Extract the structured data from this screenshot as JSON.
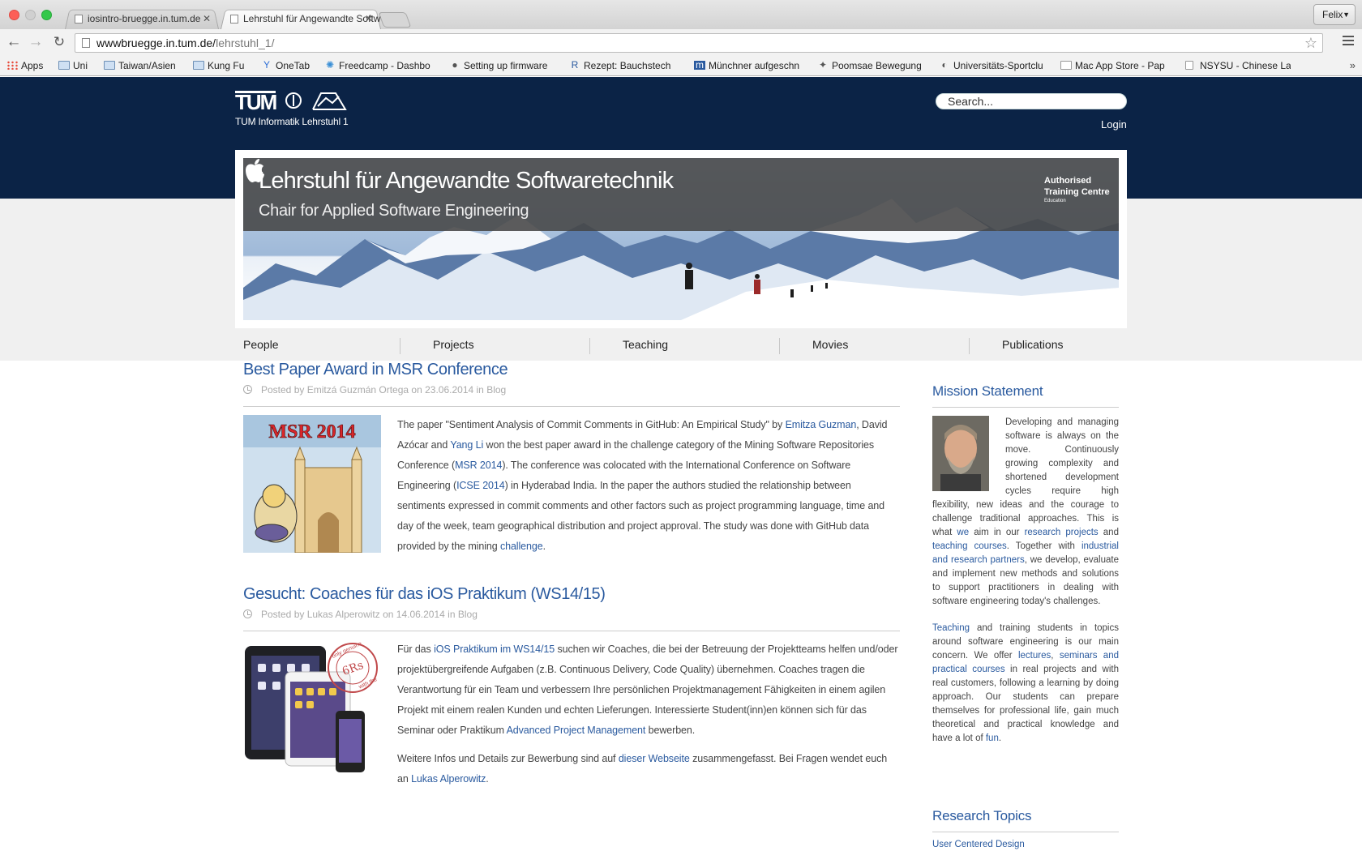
{
  "browser": {
    "tabs": [
      {
        "label": "iosintro-bruegge.in.tum.de"
      },
      {
        "label": "Lehrstuhl für Angewandte Softw"
      }
    ],
    "profile": "Felix",
    "url_host": "wwwbruegge.in.tum.de/",
    "url_path": "lehrstuhl_1/",
    "bookmarks": [
      {
        "label": "Apps",
        "icon": "apps-grid-icon"
      },
      {
        "label": "Uni",
        "icon": "folder-icon"
      },
      {
        "label": "Taiwan/Asien",
        "icon": "folder-icon"
      },
      {
        "label": "Kung Fu",
        "icon": "folder-icon"
      },
      {
        "label": "OneTab",
        "icon": "onetab-icon"
      },
      {
        "label": "Freedcamp - Dashbo",
        "icon": "freedcamp-icon"
      },
      {
        "label": "Setting up firmware ",
        "icon": "apple-icon"
      },
      {
        "label": "Rezept: Bauchstech",
        "icon": "rezept-icon"
      },
      {
        "label": "Münchner aufgeschn",
        "icon": "m-icon"
      },
      {
        "label": "Poomsae Bewegung",
        "icon": "poomsae-icon"
      },
      {
        "label": "Universitäts-Sportclu",
        "icon": "steam-icon"
      },
      {
        "label": "Mac App Store - Pap",
        "icon": "page-icon"
      },
      {
        "label": "NSYSU - Chinese La",
        "icon": "page-icon"
      }
    ],
    "bookmarks_overflow": "»"
  },
  "header": {
    "logo_text": "TUM",
    "logo_subtitle": "TUM Informatik Lehrstuhl 1",
    "search_placeholder": "Search...",
    "login": "Login"
  },
  "banner": {
    "title": "Lehrstuhl für Angewandte Softwaretechnik",
    "subtitle": "Chair for Applied Software Engineering",
    "badge_line1": "Authorised",
    "badge_line2": "Training Centre",
    "badge_line3": "Education"
  },
  "nav": [
    "People",
    "Projects",
    "Teaching",
    "Movies",
    "Publications"
  ],
  "posts": [
    {
      "title": "Best Paper Award in MSR Conference",
      "meta_prefix": "Posted by ",
      "author": "Emitzá Guzmán Ortega",
      "meta_on": " on ",
      "date": "23.06.2014",
      "meta_in": " in ",
      "category": "Blog",
      "image_text": "MSR 2014",
      "t1": "The paper \"Sentiment Analysis of Commit Comments in GitHub: An Empirical Study\" by ",
      "l1": "Emitza Guzman",
      "t2": ", David Azócar and ",
      "l2": "Yang Li",
      "t3": " won the best paper award in the challenge category of the Mining Software Repositories Conference (",
      "l3": "MSR 2014",
      "t4": "). The conference was colocated with the International Conference on Software Engineering (",
      "l4": "ICSE 2014",
      "t5": ") in Hyderabad India. In the paper the authors studied the relationship between sentiments expressed in commit comments and other factors such as project programming language, time and day of the week, team geographical distribution and project approval. The study was done with GitHub data provided by the mining ",
      "l5": "challenge",
      "t6": "."
    },
    {
      "title": "Gesucht: Coaches für das iOS Praktikum (WS14/15)",
      "meta_prefix": "Posted by ",
      "author": "Lukas Alperowitz",
      "meta_on": " on ",
      "date": "14.06.2014",
      "meta_in": " in ",
      "category": "Blog",
      "stamp_top": "only genuine",
      "stamp_mid": "6Rs",
      "stamp_bottom": "with the",
      "t1": "Für das ",
      "l1": "iOS Praktikum im WS14/15",
      "t2": " suchen wir Coaches, die bei der Betreuung der Projektteams helfen und/oder projektübergreifende Aufgaben (z.B. Continuous Delivery, Code Quality) übernehmen. Coaches tragen die Verantwortung für ein Team und verbessern Ihre persönlichen Projektmanagement Fähigkeiten in einem agilen Projekt mit einem realen Kunden und echten Lieferungen. Interessierte Student(inn)en können sich für das Seminar oder Praktikum ",
      "l2": "Advanced Project Management",
      "t3": " bewerben.",
      "p2_t1": "Weitere Infos und Details zur Bewerbung sind auf ",
      "p2_l1": "dieser Webseite",
      "p2_t2": " zusammengefasst. Bei Fragen wendet euch an ",
      "p2_l2": "Lukas Alperowitz",
      "p2_t3": "."
    }
  ],
  "sidebar": {
    "mission_title": "Mission Statement",
    "m1": "Developing and managing software is always on the move. Continuously growing complexity and shortened development cycles require high flexibility, new ideas and the courage to challenge traditional approaches. This is what ",
    "m_l1": "we",
    "m2": " aim in our ",
    "m_l2": "research projects",
    "m3": " and ",
    "m_l3": "teaching courses",
    "m4": ". Together with ",
    "m_l4": "industrial and research partners",
    "m5": ", we develop, evaluate and implement new methods and solutions to support practitioners in dealing with software engineering today's challenges.",
    "p2_l1": "Teaching",
    "p2_t1": " and training students in topics around software engineering is our main concern. We offer ",
    "p2_l2": "lectures",
    "p2_t2": ", ",
    "p2_l3": "seminars and practical courses",
    "p2_t3": " in real projects and with real customers, following a learning by doing approach. Our students can prepare themselves for professional life, gain much theoretical and practical knowledge and have a lot of ",
    "p2_l4": "fun",
    "p2_t4": ".",
    "research_title": "Research Topics",
    "research_first": "User Centered Design"
  },
  "colors": {
    "header_bg": "#0b2346",
    "link": "#2a5a9f"
  }
}
